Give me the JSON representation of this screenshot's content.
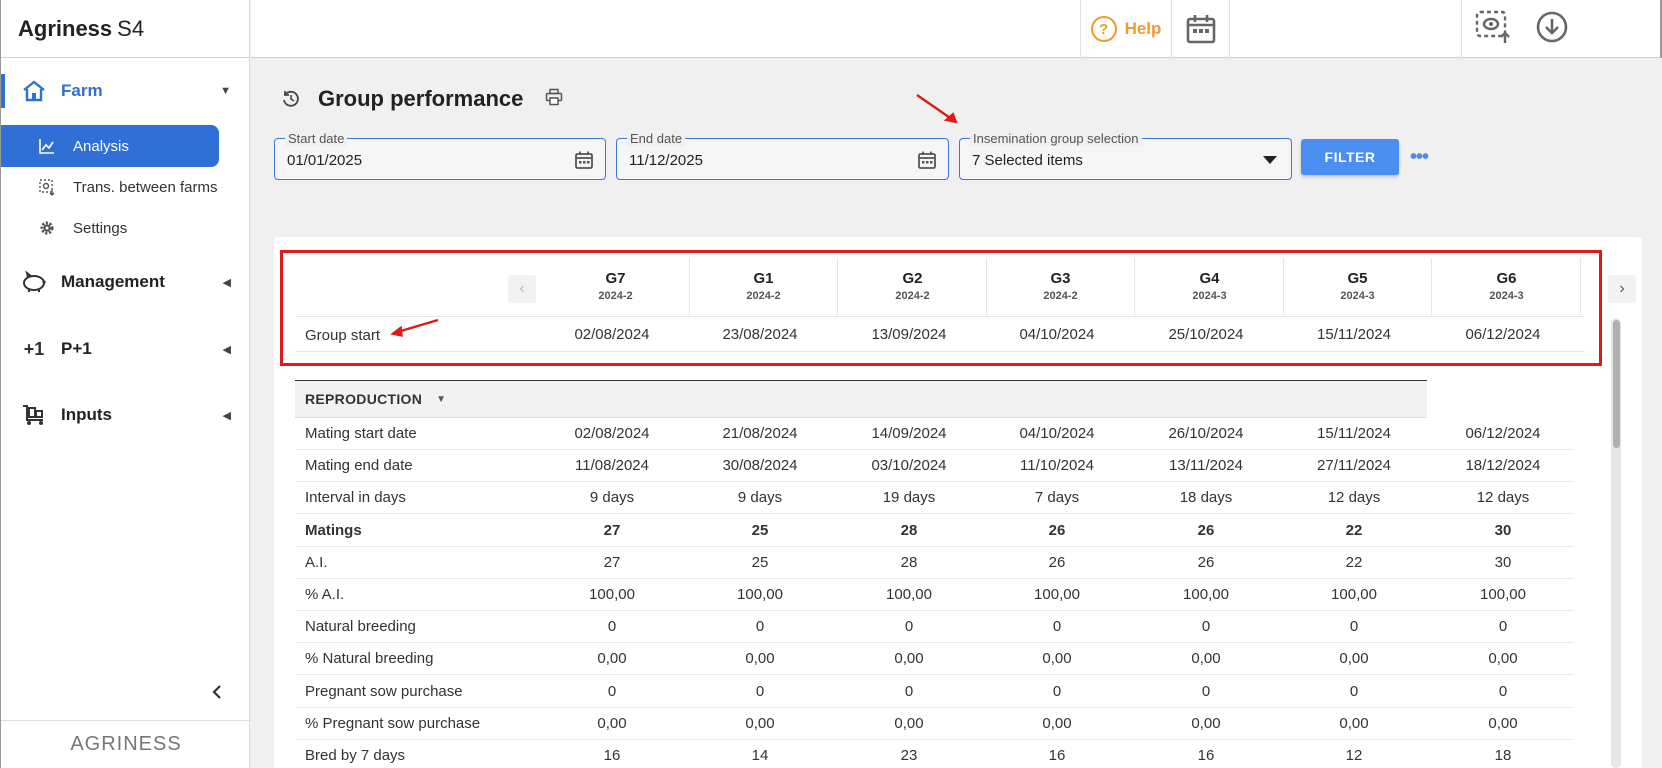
{
  "app": {
    "name_bold": "Agriness",
    "name_light": "S4",
    "footer_logo": "AGRINESS"
  },
  "sidebar": {
    "sections": [
      {
        "label": "Farm",
        "icon": "home-icon",
        "state": "expanded"
      },
      {
        "label": "Management",
        "icon": "pig-icon",
        "state": "collapsed"
      },
      {
        "label": "P+1",
        "icon": "plus-one-icon",
        "state": "collapsed"
      },
      {
        "label": "Inputs",
        "icon": "cart-icon",
        "state": "collapsed"
      }
    ],
    "farm_items": [
      {
        "label": "Analysis",
        "icon": "chart-line-icon",
        "active": true
      },
      {
        "label": "Trans. between farms",
        "icon": "transfer-icon",
        "active": false
      },
      {
        "label": "Settings",
        "icon": "gear-icon",
        "active": false
      }
    ]
  },
  "topbar": {
    "help_label": "Help"
  },
  "page": {
    "title": "Group performance"
  },
  "filters": {
    "start_date": {
      "label": "Start date",
      "value": "01/01/2025"
    },
    "end_date": {
      "label": "End date",
      "value": "11/12/2025"
    },
    "group_selection": {
      "label": "Insemination group selection",
      "value": "7 Selected items"
    },
    "filter_button": "FILTER",
    "more": "•••"
  },
  "groups": [
    {
      "name": "G7",
      "period": "2024-2",
      "start": "02/08/2024"
    },
    {
      "name": "G1",
      "period": "2024-2",
      "start": "23/08/2024"
    },
    {
      "name": "G2",
      "period": "2024-2",
      "start": "13/09/2024"
    },
    {
      "name": "G3",
      "period": "2024-2",
      "start": "04/10/2024"
    },
    {
      "name": "G4",
      "period": "2024-3",
      "start": "25/10/2024"
    },
    {
      "name": "G5",
      "period": "2024-3",
      "start": "15/11/2024"
    },
    {
      "name": "G6",
      "period": "2024-3",
      "start": "06/12/2024"
    }
  ],
  "group_start_label": "Group start",
  "section": {
    "title": "REPRODUCTION"
  },
  "rows": [
    {
      "label": "Mating start date",
      "bold": false,
      "values": [
        "02/08/2024",
        "21/08/2024",
        "14/09/2024",
        "04/10/2024",
        "26/10/2024",
        "15/11/2024",
        "06/12/2024"
      ]
    },
    {
      "label": "Mating end date",
      "bold": false,
      "values": [
        "11/08/2024",
        "30/08/2024",
        "03/10/2024",
        "11/10/2024",
        "13/11/2024",
        "27/11/2024",
        "18/12/2024"
      ]
    },
    {
      "label": "Interval in days",
      "bold": false,
      "values": [
        "9 days",
        "9 days",
        "19 days",
        "7 days",
        "18 days",
        "12 days",
        "12 days"
      ]
    },
    {
      "label": "Matings",
      "bold": true,
      "values": [
        "27",
        "25",
        "28",
        "26",
        "26",
        "22",
        "30"
      ]
    },
    {
      "label": "A.I.",
      "bold": false,
      "values": [
        "27",
        "25",
        "28",
        "26",
        "26",
        "22",
        "30"
      ]
    },
    {
      "label": "% A.I.",
      "bold": false,
      "values": [
        "100,00",
        "100,00",
        "100,00",
        "100,00",
        "100,00",
        "100,00",
        "100,00"
      ]
    },
    {
      "label": "Natural breeding",
      "bold": false,
      "values": [
        "0",
        "0",
        "0",
        "0",
        "0",
        "0",
        "0"
      ]
    },
    {
      "label": "% Natural breeding",
      "bold": false,
      "values": [
        "0,00",
        "0,00",
        "0,00",
        "0,00",
        "0,00",
        "0,00",
        "0,00"
      ]
    },
    {
      "label": "Pregnant sow purchase",
      "bold": false,
      "values": [
        "0",
        "0",
        "0",
        "0",
        "0",
        "0",
        "0"
      ]
    },
    {
      "label": "% Pregnant sow purchase",
      "bold": false,
      "values": [
        "0,00",
        "0,00",
        "0,00",
        "0,00",
        "0,00",
        "0,00",
        "0,00"
      ]
    },
    {
      "label": "Bred by 7 days",
      "bold": false,
      "values": [
        "16",
        "14",
        "23",
        "16",
        "16",
        "12",
        "18"
      ]
    }
  ],
  "colors": {
    "accent": "#2f6fd6",
    "help": "#f29a2e",
    "annotation": "#e01a1a",
    "button": "#4a8ef0"
  }
}
